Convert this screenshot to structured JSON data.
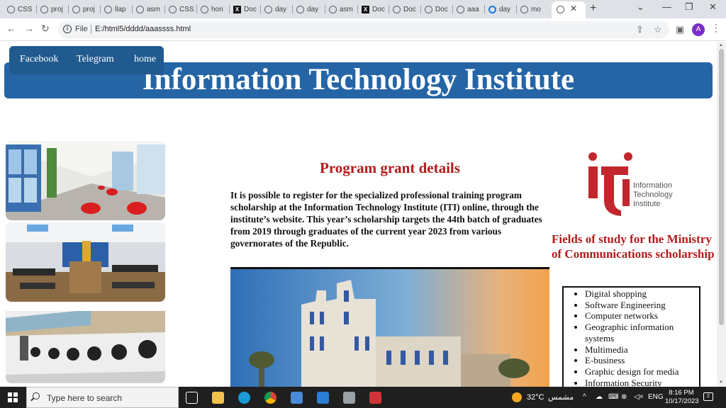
{
  "browser": {
    "tabs": [
      {
        "title": "CSS",
        "icon": "globe-icon"
      },
      {
        "title": "proj",
        "icon": "globe-icon"
      },
      {
        "title": "proj",
        "icon": "globe-icon"
      },
      {
        "title": "llap",
        "icon": "globe-icon"
      },
      {
        "title": "asm",
        "icon": "globe-icon"
      },
      {
        "title": "CSS",
        "icon": "globe-icon"
      },
      {
        "title": "hon",
        "icon": "globe-icon"
      },
      {
        "title": "Doc",
        "icon": "x-logo-icon"
      },
      {
        "title": "day",
        "icon": "globe-icon"
      },
      {
        "title": "day",
        "icon": "globe-icon"
      },
      {
        "title": "asm",
        "icon": "globe-icon"
      },
      {
        "title": "Doc",
        "icon": "x-logo-icon"
      },
      {
        "title": "Doc",
        "icon": "globe-icon"
      },
      {
        "title": "Doc",
        "icon": "globe-icon"
      },
      {
        "title": "aaa",
        "icon": "globe-icon"
      },
      {
        "title": "day",
        "icon": "chrome-icon"
      },
      {
        "title": "mo",
        "icon": "globe-icon"
      }
    ],
    "address": {
      "scheme_label": "File",
      "url": "E:/html5/dddd/aaassss.html"
    },
    "profile_initial": "A"
  },
  "page": {
    "nav": {
      "facebook": "Facebook",
      "telegram": "Telegram",
      "home": "home"
    },
    "title": "Information Technology Institute",
    "grant": {
      "heading": "Program grant details",
      "text": "It is possible to register for the specialized professional training program scholarship at the Information Technology Institute (ITI) online, through the institute’s website. This year’s scholarship targets the 44th batch of graduates from 2019 through graduates of the current year 2023 from various governorates of the Republic."
    },
    "logo": {
      "line1": "Information",
      "line2": "Technology",
      "line3": "Institute"
    },
    "fields": {
      "heading": "Fields of study for the Ministry of Communications scholarship",
      "items": [
        "Digital shopping",
        "Software Engineering",
        "Computer networks",
        "Geographic information systems",
        "Multimedia",
        "E-business",
        "Graphic design for media",
        "Information Security"
      ]
    }
  },
  "taskbar": {
    "search_placeholder": "Type here to search",
    "weather": "32°C",
    "weather_desc": "مشمس",
    "language": "ENG",
    "time": "8:16 PM",
    "date": "10/17/2023",
    "notification_count": "2"
  },
  "colors": {
    "header_blue": "#2565a6",
    "heading_red": "#b31b1b"
  }
}
